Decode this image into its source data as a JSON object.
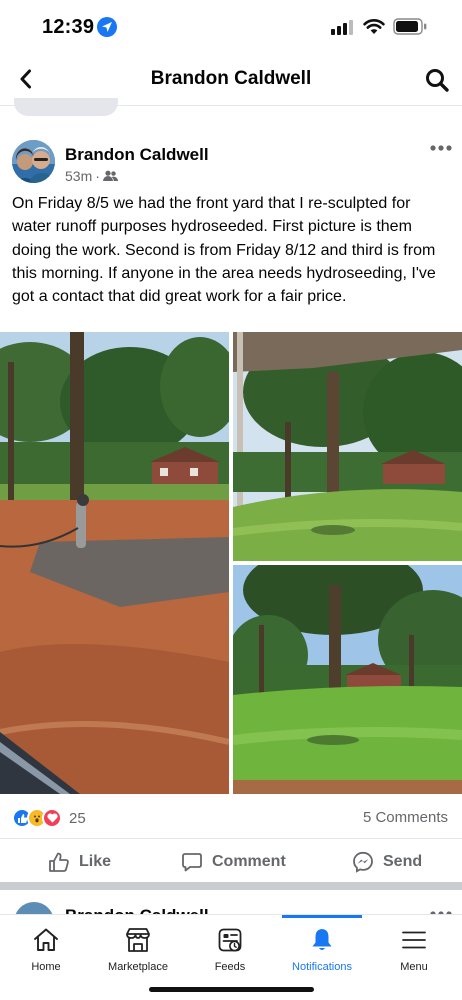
{
  "status_bar": {
    "time": "12:39"
  },
  "header": {
    "title": "Brandon Caldwell"
  },
  "post": {
    "author": "Brandon Caldwell",
    "age": "53m",
    "audience_icon": "friends-icon",
    "text": "On Friday 8/5 we had the front yard that I re-sculpted for water runoff purposes hydroseeded. First picture is them doing the work. Second is from Friday 8/12 and third is from this morning. If anyone in the area needs hydroseeding, I've got a contact that did great work for a fair price.",
    "reactions": {
      "types": [
        "like",
        "wow",
        "love"
      ],
      "count": "25"
    },
    "comments_label": "5 Comments",
    "actions": {
      "like": "Like",
      "comment": "Comment",
      "send": "Send"
    }
  },
  "next_post": {
    "author": "Brandon Caldwell"
  },
  "tabs": [
    {
      "label": "Home",
      "icon": "home-icon",
      "active": false
    },
    {
      "label": "Marketplace",
      "icon": "marketplace-icon",
      "active": false
    },
    {
      "label": "Feeds",
      "icon": "feeds-icon",
      "active": false
    },
    {
      "label": "Notifications",
      "icon": "bell-icon",
      "active": true
    },
    {
      "label": "Menu",
      "icon": "menu-icon",
      "active": false
    }
  ],
  "colors": {
    "accent": "#1877f2",
    "secondary_text": "#65676b",
    "divider": "#e4e6eb"
  }
}
